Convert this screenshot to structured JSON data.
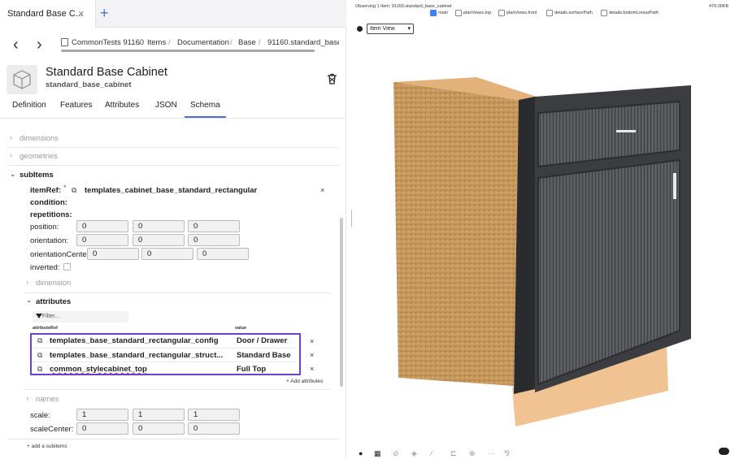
{
  "tab": {
    "title": "Standard Base C...",
    "close": "×",
    "new": "+"
  },
  "nav": {
    "back": "‹",
    "forward": "›"
  },
  "breadcrumb": [
    "CommonTests 91160",
    "Items",
    "Documentation",
    "Base",
    "91160.standard_base_ca"
  ],
  "item": {
    "title": "Standard Base Cabinet",
    "subtitle": "standard_base_cabinet"
  },
  "tabs": [
    "Definition",
    "Features",
    "Attributes",
    "JSON",
    "Schema"
  ],
  "active_tab": "Schema",
  "schema": {
    "dimensions": "dimensions",
    "geometries": "geometries",
    "subitems": "subItems",
    "itemref_label": "itemRef:",
    "required_mark": "*",
    "itemref_value": "templates_cabinet_base_standard_rectangular",
    "condition": "condition:",
    "repetitions": "repetitions:",
    "position_label": "position:",
    "position": [
      "0",
      "0",
      "0"
    ],
    "orientation_label": "orientation:",
    "orientation": [
      "0",
      "0",
      "0"
    ],
    "orientation_center_label": "orientationCente",
    "orientation_center": [
      "0",
      "0",
      "0"
    ],
    "inverted_label": "inverted:",
    "dimension": "dimension",
    "attributes": "attributes",
    "filter_placeholder": "Filter...",
    "col_attributeRef": "attributeRef",
    "col_value": "value",
    "attr_rows": [
      {
        "ref": "templates_base_standard_rectangular_config",
        "value": "Door / Drawer"
      },
      {
        "ref": "templates_base_standard_rectangular_struct...",
        "value": "Standard Base"
      },
      {
        "ref": "common_stylecabinet_top",
        "value": "Full Top"
      }
    ],
    "add_attributes": "+ Add attributes",
    "names": "names",
    "scale_label": "scale:",
    "scale": [
      "1",
      "1",
      "1"
    ],
    "scale_center_label": "scaleCenter:",
    "scale_center": [
      "0",
      "0",
      "0"
    ],
    "add_subitems": "+ add a subitems",
    "remove": "×"
  },
  "viewer": {
    "observing": "Observing 1 Item: 91160.standard_base_cabinet",
    "size": "479.00KB",
    "view_options": [
      {
        "label": "main",
        "checked": true
      },
      {
        "label": "planViews.top",
        "checked": false
      },
      {
        "label": "planViews.front",
        "checked": false
      },
      {
        "label": "details.surfacePath",
        "checked": false
      },
      {
        "label": "details.bottomLinearPath",
        "checked": false
      }
    ],
    "view_mode": "Item View",
    "colors": {
      "accent": "#6a3fd1",
      "link": "#4b6fd6",
      "check": "#3b82f6"
    }
  }
}
